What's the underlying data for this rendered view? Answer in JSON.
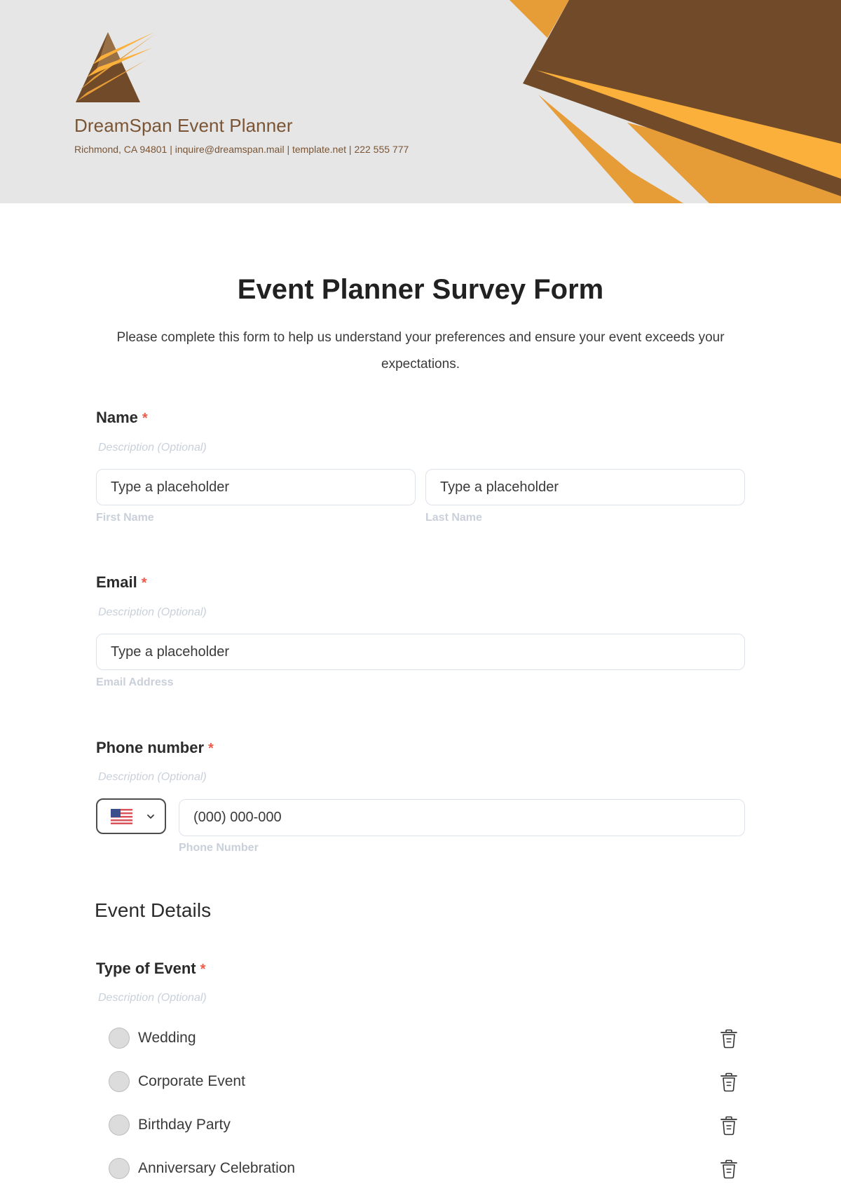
{
  "header": {
    "company_name": "DreamSpan Event Planner",
    "contact_line": "Richmond, CA 94801 | inquire@dreamspan.mail | template.net | 222 555 777",
    "logo_icon": "pyramid-streak-logo",
    "colors": {
      "brown": "#714b29",
      "orange": "#e69c37",
      "light_orange": "#fbb03b",
      "background": "#e6e6e6",
      "brand_text": "#7a5535"
    }
  },
  "form": {
    "title": "Event Planner Survey Form",
    "intro": "Please complete this form to help us understand your preferences and ensure your event exceeds your expectations.",
    "required_mark": "*",
    "required_color": "#ef5a4a",
    "fields": {
      "name": {
        "label": "Name",
        "description": "Description (Optional)",
        "first": {
          "placeholder": "Type a placeholder",
          "sublabel": "First Name"
        },
        "last": {
          "placeholder": "Type a placeholder",
          "sublabel": "Last Name"
        }
      },
      "email": {
        "label": "Email",
        "description": "Description (Optional)",
        "placeholder": "Type a placeholder",
        "sublabel": "Email Address"
      },
      "phone": {
        "label": "Phone number",
        "description": "Description (Optional)",
        "country_icon": "us-flag-icon",
        "placeholder": "(000) 000-000",
        "sublabel": "Phone Number"
      }
    },
    "sections": {
      "event_details": {
        "heading": "Event Details",
        "type_of_event": {
          "label": "Type of Event",
          "description": "Description (Optional)",
          "options": [
            {
              "label": "Wedding",
              "delete_icon": "trash-icon"
            },
            {
              "label": "Corporate Event",
              "delete_icon": "trash-icon"
            },
            {
              "label": "Birthday Party",
              "delete_icon": "trash-icon"
            },
            {
              "label": "Anniversary Celebration",
              "delete_icon": "trash-icon"
            }
          ]
        }
      }
    }
  }
}
